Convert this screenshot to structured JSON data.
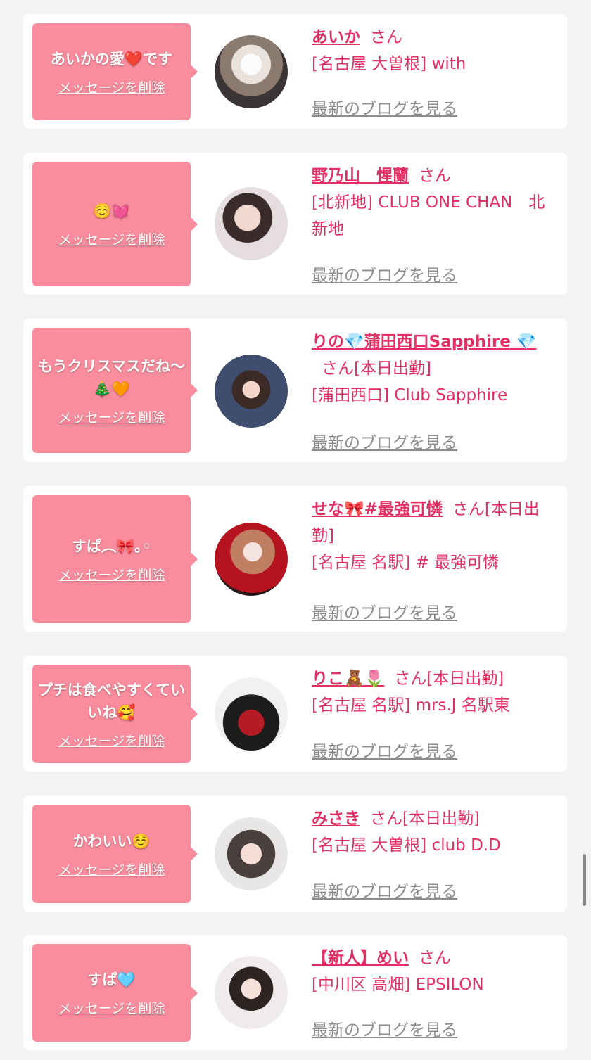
{
  "delete_label": "メッセージを削除",
  "blog_label": "最新のブログを見る",
  "honorific": "さん",
  "colors": {
    "bubble": "#f98d9d",
    "name": "#e22f64",
    "link_gray": "#8d8d8d"
  },
  "entries": [
    {
      "message": "あいかの愛❤️です",
      "name": "あいか",
      "tag": "",
      "store": "[名古屋 大曽根] with"
    },
    {
      "message": "☺️💓",
      "name": "野乃山　惺蘭",
      "tag": "",
      "store": "[北新地] CLUB ONE CHAN　北新地"
    },
    {
      "message": "もうクリスマスだね〜🎄🧡",
      "name": "りの💎蒲田西口Sapphire 💎",
      "tag": "[本日出勤]",
      "store": "[蒲田西口] Club Sapphire"
    },
    {
      "message": "すぱ︵🎀｡◦",
      "name": "せな🎀#最強可憐",
      "tag": "[本日出勤]",
      "store": "[名古屋 名駅]  # 最強可憐"
    },
    {
      "message": "プチは食べやすくていいね🥰",
      "name": "りこ🧸🌷",
      "tag": "[本日出勤]",
      "store": "[名古屋 名駅] mrs.J 名駅東"
    },
    {
      "message": "かわいい☺️",
      "name": "みさき",
      "tag": "[本日出勤]",
      "store": "[名古屋 大曽根] club D.D"
    },
    {
      "message": "すぱ🩵",
      "name": "【新人】めい",
      "tag": "",
      "store": "[中川区 高畑] EPSILON"
    }
  ]
}
